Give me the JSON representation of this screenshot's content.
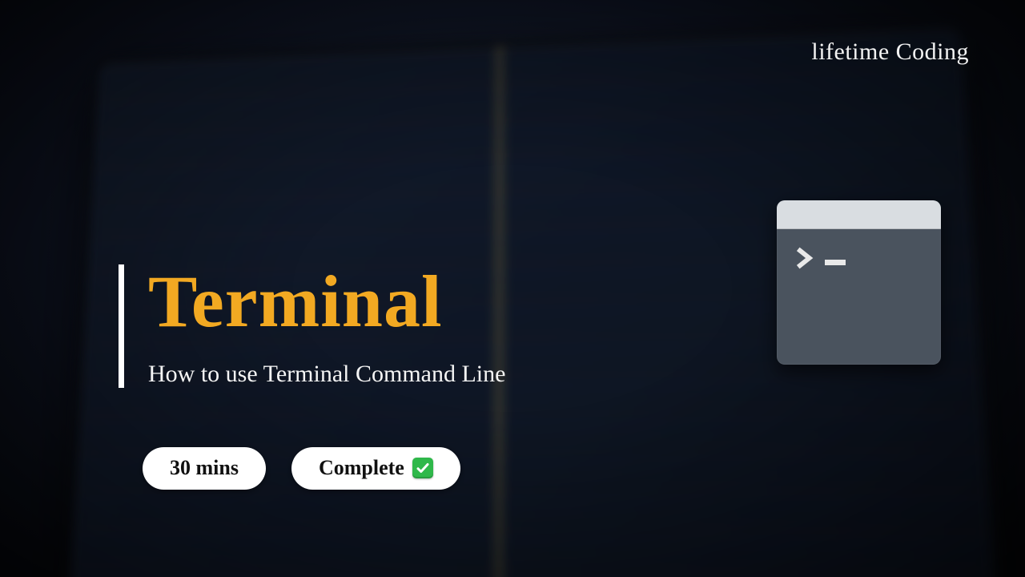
{
  "brand": "lifetime Coding",
  "title": "Terminal",
  "subtitle": "How to use Terminal Command Line",
  "pills": {
    "duration": "30 mins",
    "status": "Complete"
  },
  "colors": {
    "accent": "#f2a922",
    "check_green": "#2fb84a"
  }
}
